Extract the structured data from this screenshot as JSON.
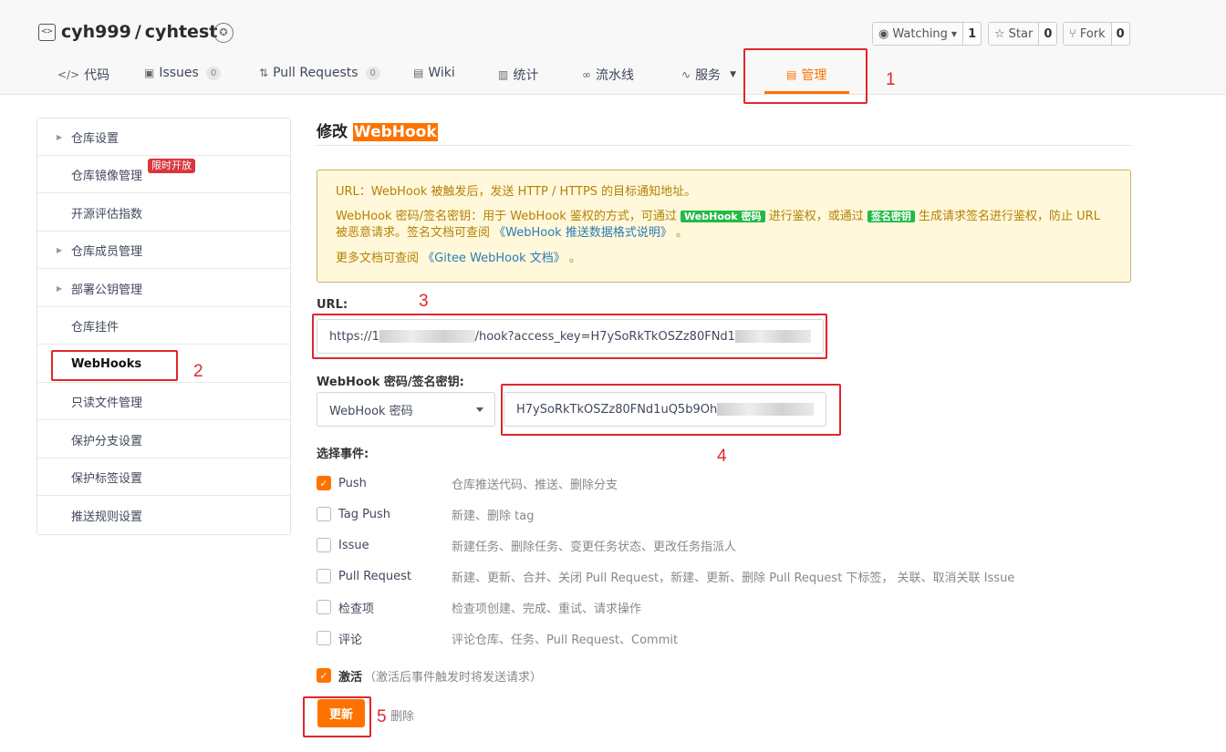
{
  "repo": {
    "owner": "cyh999",
    "separator": "/",
    "name": "cyhtest"
  },
  "social": {
    "watching": {
      "label": "Watching",
      "count": "1"
    },
    "star": {
      "label": "Star",
      "count": "0"
    },
    "fork": {
      "label": "Fork",
      "count": "0"
    }
  },
  "tabs": [
    {
      "label": "代码"
    },
    {
      "label": "Issues",
      "count": "0"
    },
    {
      "label": "Pull Requests",
      "count": "0"
    },
    {
      "label": "Wiki"
    },
    {
      "label": "统计"
    },
    {
      "label": "流水线"
    },
    {
      "label": "服务"
    },
    {
      "label": "管理"
    }
  ],
  "sidebar": {
    "items": [
      {
        "label": "仓库设置"
      },
      {
        "label": "仓库镜像管理"
      },
      {
        "label": "开源评估指数"
      },
      {
        "label": "仓库成员管理"
      },
      {
        "label": "部署公钥管理"
      },
      {
        "label": "仓库挂件"
      },
      {
        "label": "WebHooks"
      },
      {
        "label": "只读文件管理"
      },
      {
        "label": "保护分支设置"
      },
      {
        "label": "保护标签设置"
      },
      {
        "label": "推送规则设置"
      }
    ],
    "limited_tag": "限时开放"
  },
  "page": {
    "title_prefix": "修改",
    "title_highlight": "WebHook"
  },
  "notice": {
    "line1": "URL：WebHook 被触发后，发送 HTTP / HTTPS 的目标通知地址。",
    "line2_a": "WebHook 密码/签名密钥：用于 WebHook 鉴权的方式，可通过",
    "badge_password": "WebHook 密码",
    "line2_b": "进行鉴权，或通过",
    "badge_signature": "签名密钥",
    "line2_c": "生成请求签名进行鉴权，防止 URL 被恶意请求。签名文档可查阅",
    "link_format": "《WebHook 推送数据格式说明》",
    "line2_end": "。",
    "line3_a": "更多文档可查阅",
    "link_docs": "《Gitee WebHook 文档》",
    "line3_end": "。"
  },
  "form": {
    "url_label": "URL:",
    "url_value_start": "https://1",
    "url_value_mid": "/hook?access_key=H7ySoRkTkOSZz80FNd1",
    "secret_label": "WebHook 密码/签名密钥:",
    "secret_type": "WebHook 密码",
    "secret_value": "H7ySoRkTkOSZz80FNd1uQ5b9Oh",
    "events_label": "选择事件:",
    "events": [
      {
        "name": "Push",
        "desc": "仓库推送代码、推送、删除分支",
        "checked": true
      },
      {
        "name": "Tag Push",
        "desc": "新建、删除 tag",
        "checked": false
      },
      {
        "name": "Issue",
        "desc": "新建任务、删除任务、变更任务状态、更改任务指派人",
        "checked": false
      },
      {
        "name": "Pull Request",
        "desc": "新建、更新、合并、关闭 Pull Request，新建、更新、删除 Pull Request 下标签， 关联、取消关联 Issue",
        "checked": false
      },
      {
        "name": "检查项",
        "desc": "检查项创建、完成、重试、请求操作",
        "checked": false
      },
      {
        "name": "评论",
        "desc": "评论仓库、任务、Pull Request、Commit",
        "checked": false
      }
    ],
    "activate_label": "激活",
    "activate_hint": "（激活后事件触发时将发送请求）",
    "activate_checked": true,
    "update_button": "更新",
    "delete_link": "删除"
  },
  "annotations": [
    "1",
    "2",
    "3",
    "4",
    "5"
  ],
  "colors": {
    "accent": "#fe7300",
    "annotation": "#e0262c",
    "notice_bg": "#fff8db",
    "green_badge": "#21ba45"
  }
}
